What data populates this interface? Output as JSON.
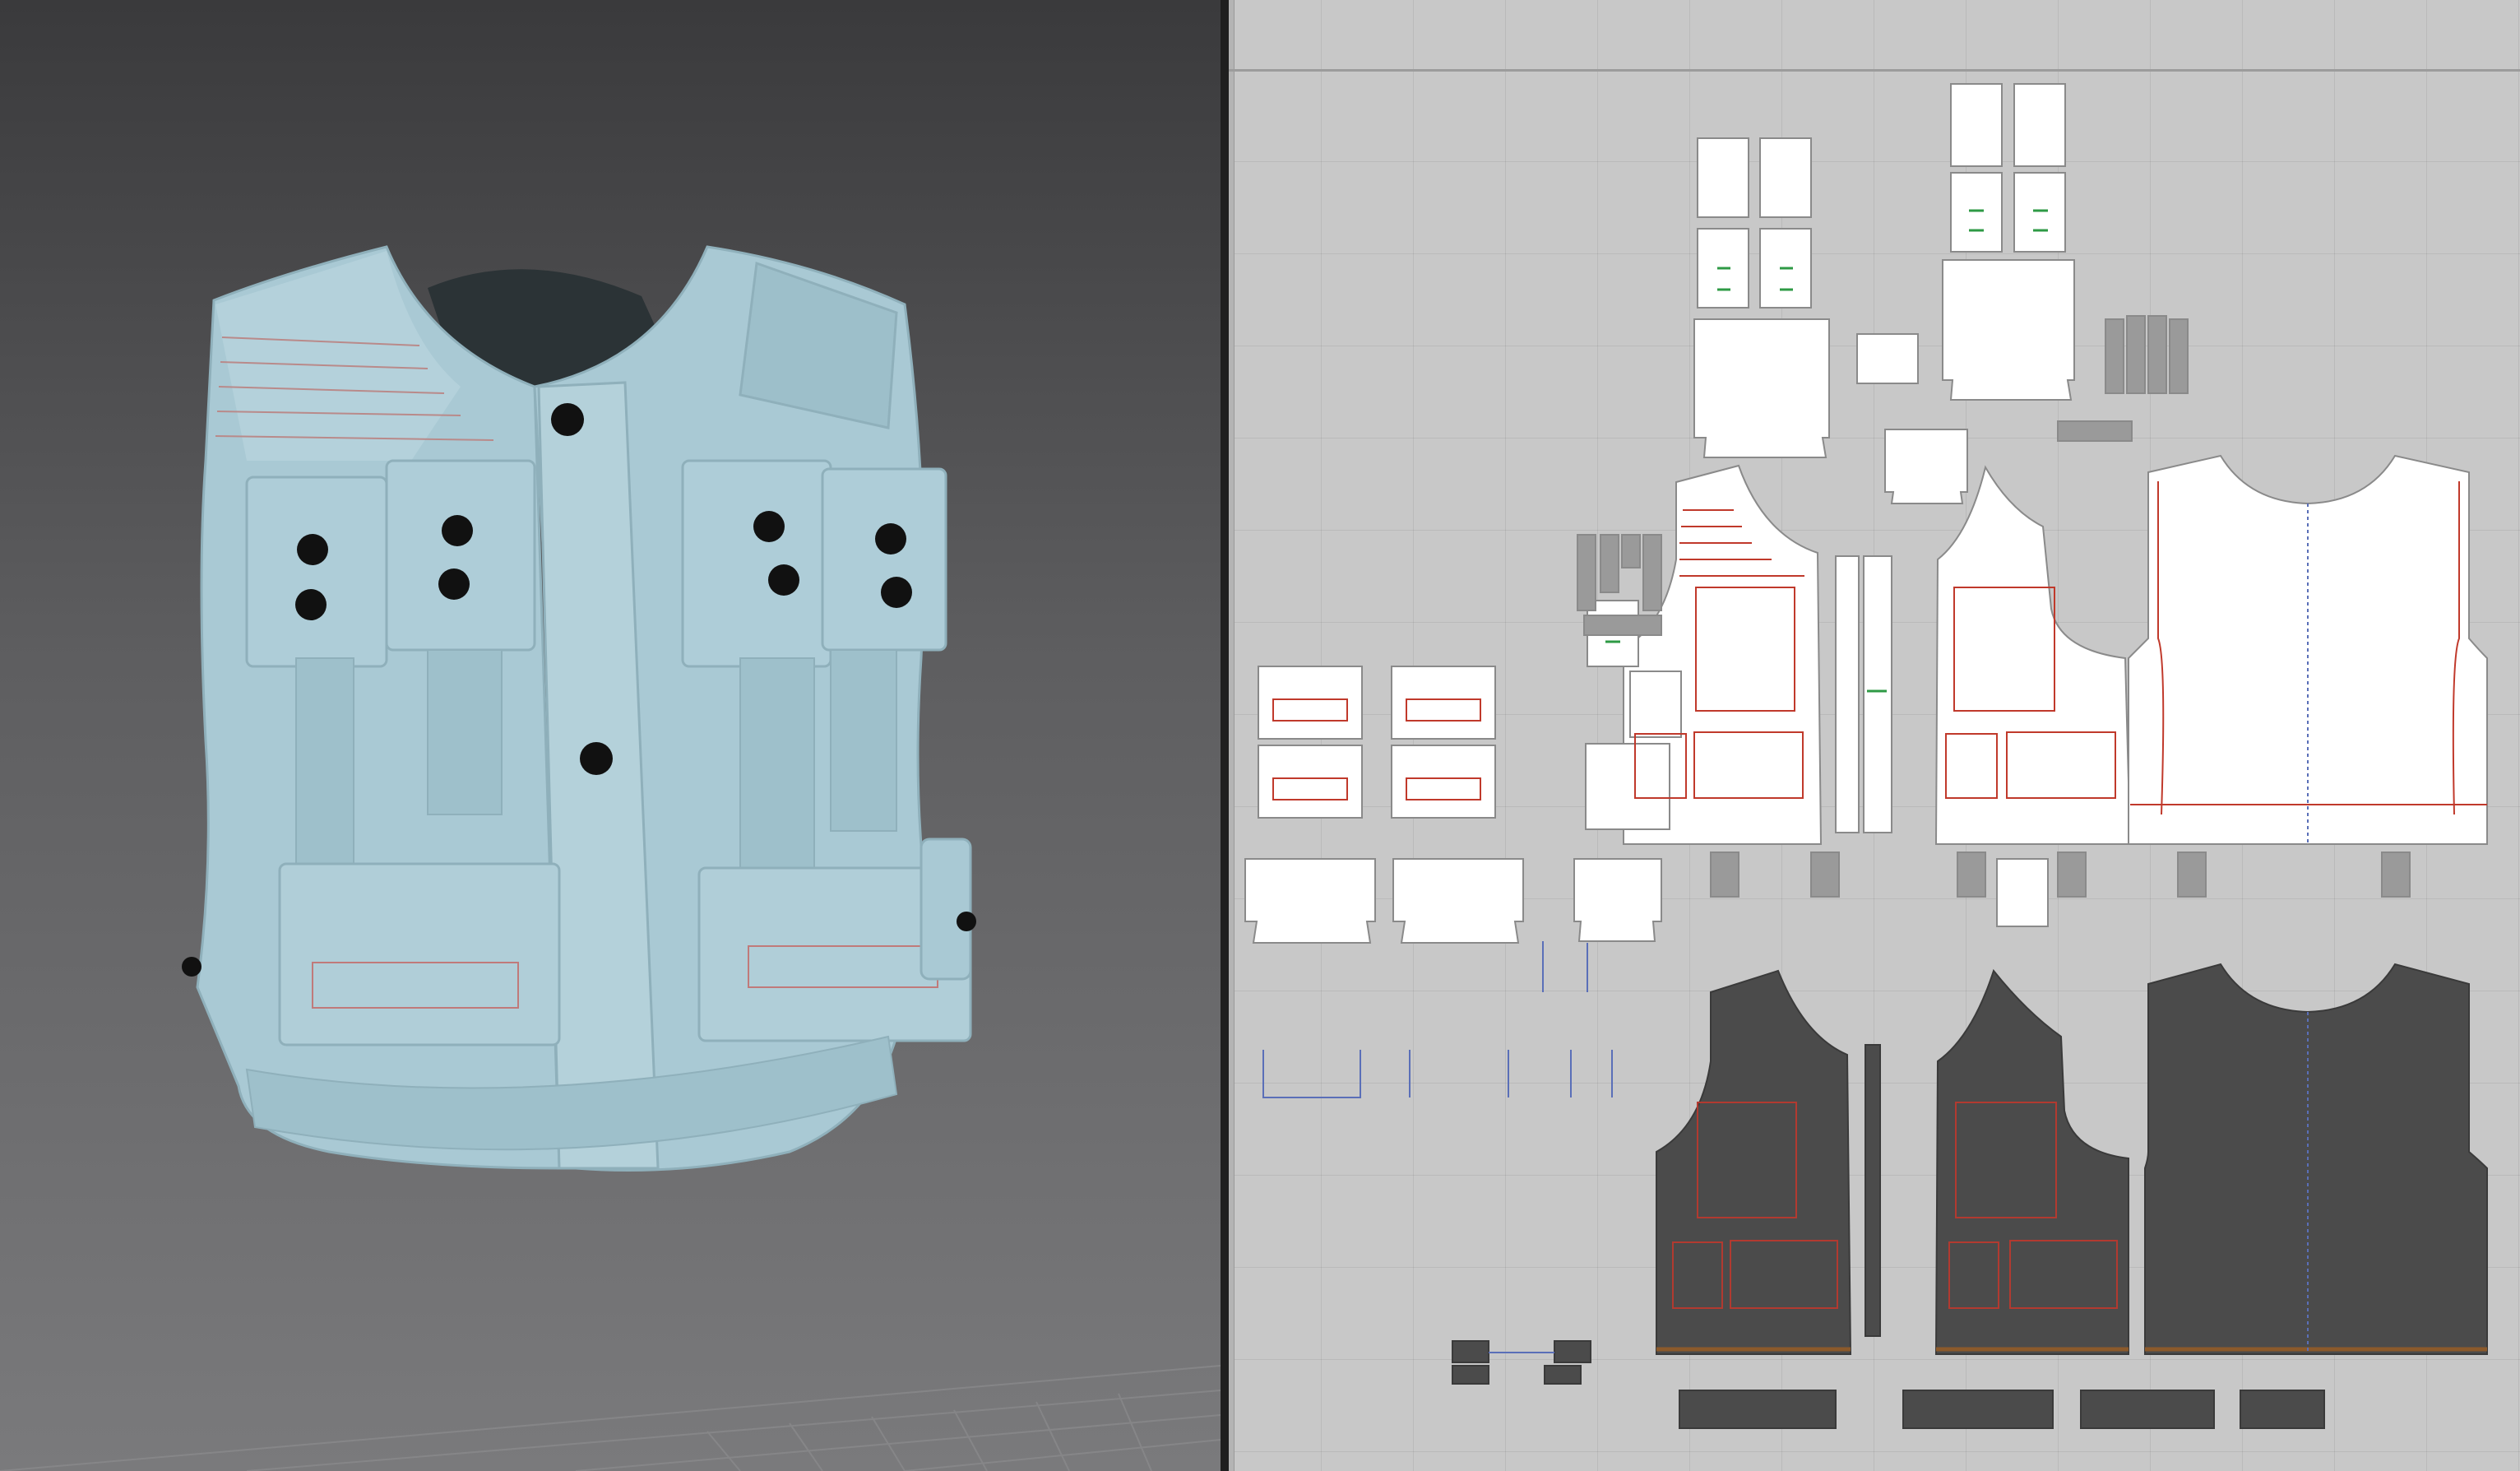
{
  "app": {
    "views": {
      "viewport_3d": "3d-avatar-viewport",
      "viewport_2d": "2d-pattern-viewport"
    }
  },
  "colors": {
    "garment_fabric": "#a9c9d4",
    "garment_shadow": "#7fa2ad",
    "collar_interior": "#2b3336",
    "button": "#111111",
    "pattern_piece_fill": "#ffffff",
    "pattern_piece_stroke": "#8a8a8a",
    "internal_line": "#c0392b",
    "baseline_pattern_fill": "#4b4b4b",
    "hem_accent": "#8b5a2b",
    "blue_line": "#5a6fb8"
  },
  "icons": [
    "button-icon",
    "grain-line-icon",
    "sewing-line-icon"
  ]
}
